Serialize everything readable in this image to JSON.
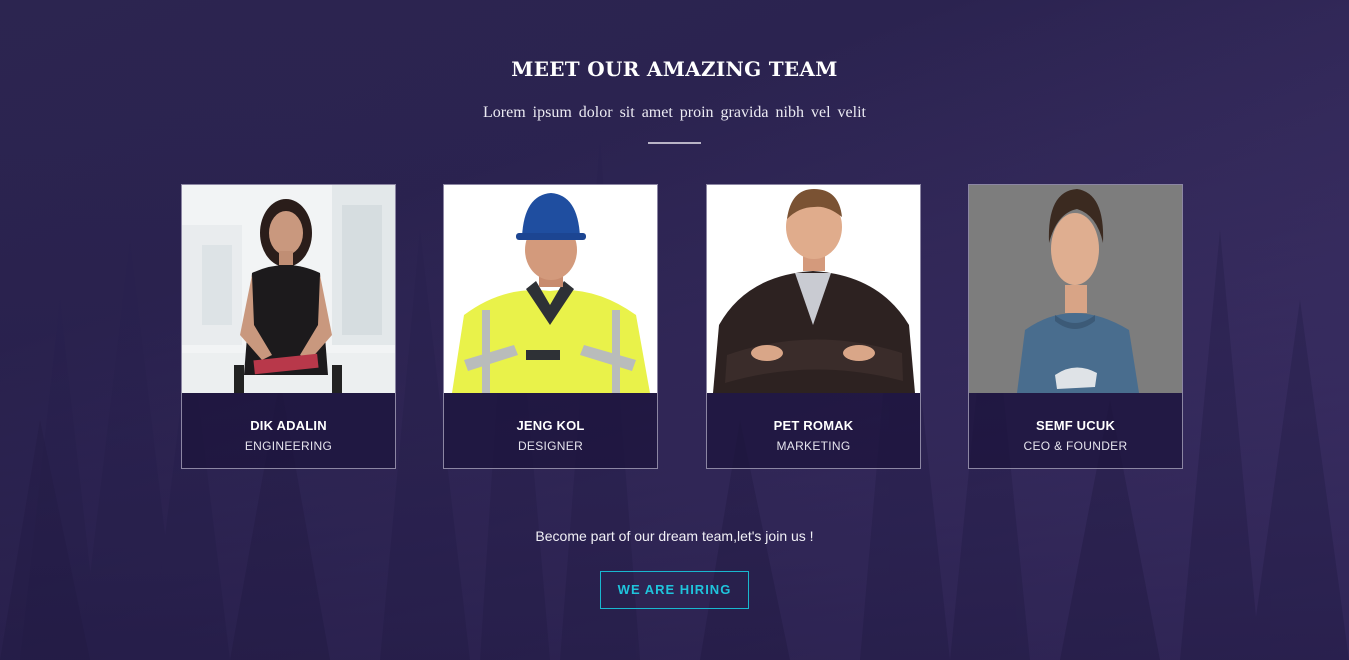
{
  "section": {
    "title": "MEET OUR AMAZING TEAM",
    "subtitle": "Lorem ipsum dolor sit amet proin gravida nibh vel velit"
  },
  "team": [
    {
      "name": "DIK ADALIN",
      "role": "ENGINEERING",
      "photo": "woman-seated-office-photo"
    },
    {
      "name": "JENG KOL",
      "role": "DESIGNER",
      "photo": "construction-worker-hardhat-photo"
    },
    {
      "name": "PET ROMAK",
      "role": "MARKETING",
      "photo": "man-blazer-arms-crossed-photo"
    },
    {
      "name": "SEMF UCUK",
      "role": "CEO & FOUNDER",
      "photo": "young-man-blue-tshirt-photo"
    }
  ],
  "cta": {
    "text": "Become part of our dream team,let's join us !",
    "button_label": "WE ARE HIRING"
  },
  "colors": {
    "background": "#2c2550",
    "accent": "#1fc4dc",
    "card_border": "#8c86a3"
  }
}
